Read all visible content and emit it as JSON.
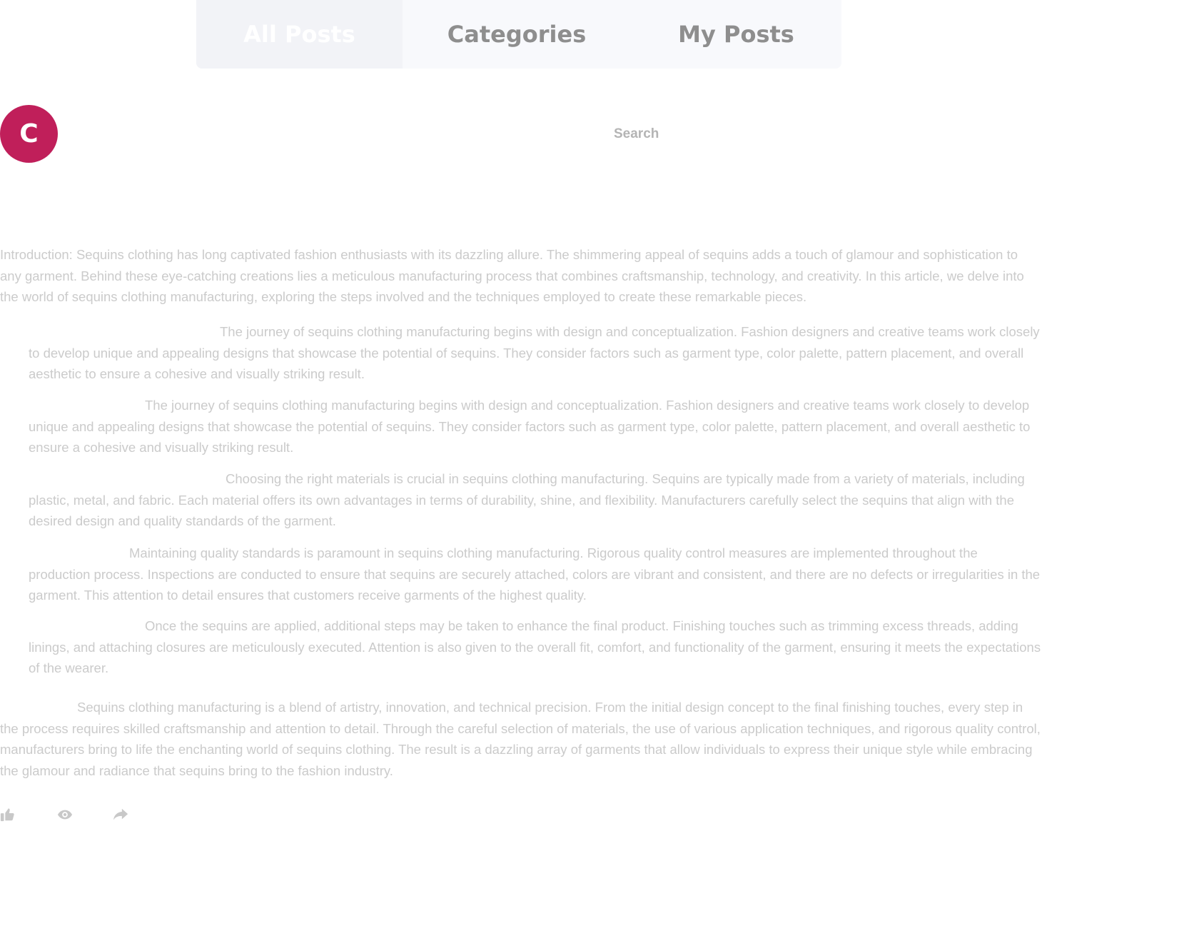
{
  "tabs": {
    "all_posts": "All Posts",
    "categories": "Categories",
    "my_posts": "My Posts"
  },
  "user": {
    "avatar_initial": "C",
    "avatar_color": "#c01f5a"
  },
  "search": {
    "placeholder": "Search"
  },
  "post": {
    "intro": "Introduction: Sequins clothing has long captivated fashion enthusiasts with its dazzling allure. The shimmering appeal of sequins adds a touch of glamour and sophistication to any garment. Behind these eye-catching creations lies a meticulous manufacturing process that combines craftsmanship, technology, and creativity. In this article, we delve into the world of sequins clothing manufacturing, exploring the steps involved and the techniques employed to create these remarkable pieces.",
    "sections": [
      "The journey of sequins clothing manufacturing begins with design and conceptualization. Fashion designers and creative teams work closely to develop unique and appealing designs that showcase the potential of sequins. They consider factors such as garment type, color palette, pattern placement, and overall aesthetic to ensure a cohesive and visually striking result.",
      "The journey of sequins clothing manufacturing begins with design and conceptualization. Fashion designers and creative teams work closely to develop unique and appealing designs that showcase the potential of sequins. They consider factors such as garment type, color palette, pattern placement, and overall aesthetic to ensure a cohesive and visually striking result.",
      "Choosing the right materials is crucial in sequins clothing manufacturing. Sequins are typically made from a variety of materials, including plastic, metal, and fabric. Each material offers its own advantages in terms of durability, shine, and flexibility. Manufacturers carefully select the sequins that align with the desired design and quality standards of the garment.",
      "Maintaining quality standards is paramount in sequins clothing manufacturing. Rigorous quality control measures are implemented throughout the production process. Inspections are conducted to ensure that sequins are securely attached, colors are vibrant and consistent, and there are no defects or irregularities in the garment. This attention to detail ensures that customers receive garments of the highest quality.",
      "Once the sequins are applied, additional steps may be taken to enhance the final product. Finishing touches such as trimming excess threads, adding linings, and attaching closures are meticulously executed. Attention is also given to the overall fit, comfort, and functionality of the garment, ensuring it meets the expectations of the wearer."
    ],
    "conclusion": "Sequins clothing manufacturing is a blend of artistry, innovation, and technical precision. From the initial design concept to the final finishing touches, every step in the process requires skilled craftsmanship and attention to detail. Through the careful selection of materials, the use of various application techniques, and rigorous quality control, manufacturers bring to life the enchanting world of sequins clothing. The result is a dazzling array of garments that allow individuals to express their unique style while embracing the glamour and radiance that sequins bring to the fashion industry."
  },
  "actions": {
    "like_icon": "thumbs-up-icon",
    "view_icon": "eye-icon",
    "share_icon": "share-arrow-icon"
  },
  "colors": {
    "text": "#cbcbcb",
    "tab_text": "#8e8e8e",
    "tab_bg": "#f8f9fc",
    "tab_active_bg": "#f2f3f7",
    "icon": "#c8c8c8"
  }
}
